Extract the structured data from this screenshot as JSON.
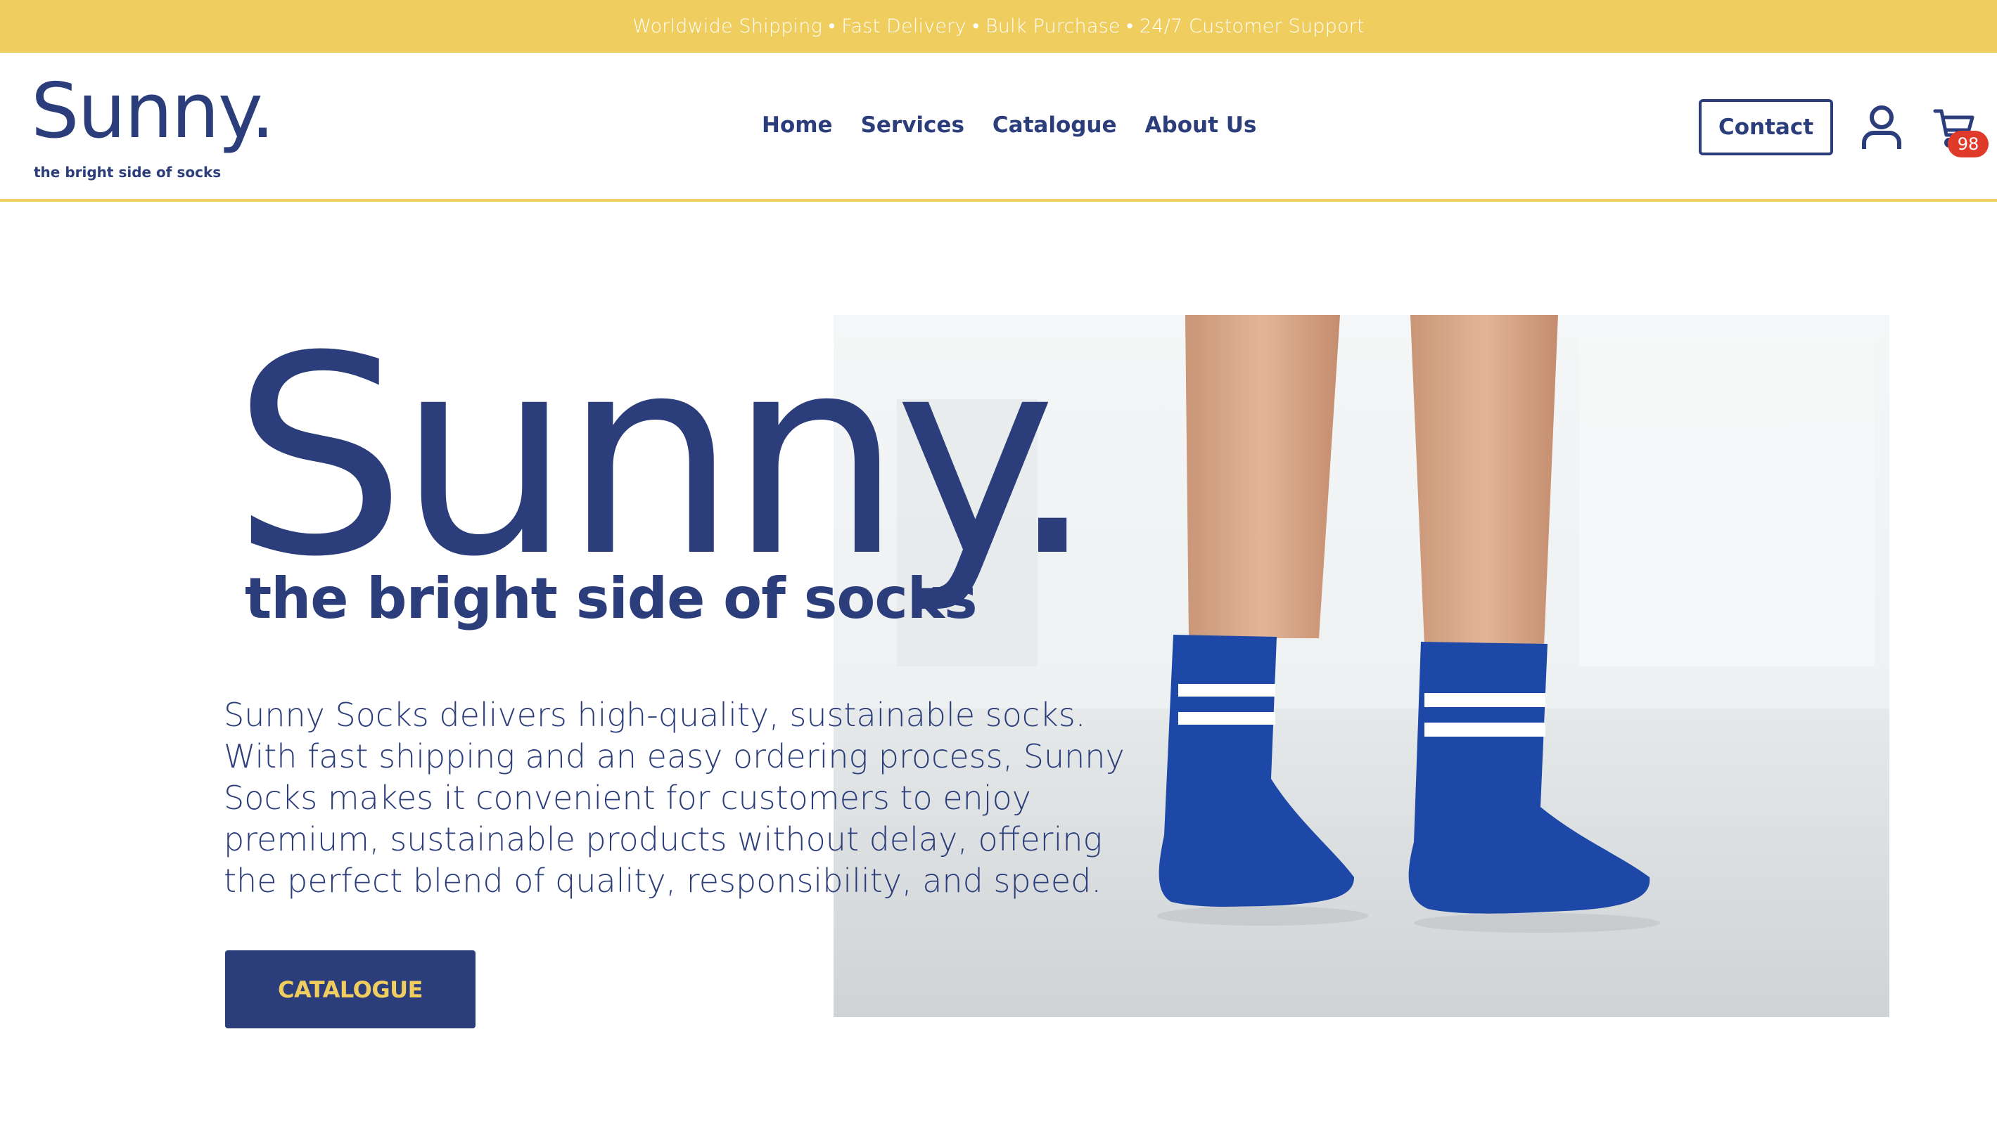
{
  "topbar": {
    "text": "Worldwide Shipping • Fast Delivery • Bulk Purchase • 24/7 Customer Support"
  },
  "brand": {
    "name": "Sunny.",
    "tagline": "the bright side of socks"
  },
  "nav": {
    "items": [
      "Home",
      "Services",
      "Catalogue",
      "About Us"
    ]
  },
  "header": {
    "contact_label": "Contact",
    "cart_count": "98"
  },
  "hero": {
    "title": "Sunny.",
    "tagline": "the bright side of socks",
    "description": "Sunny Socks delivers high-quality, sustainable socks. With fast shipping and an easy ordering process, Sunny Socks makes it convenient for customers to enjoy premium, sustainable products without delay, offering the perfect blend of quality, responsibility, and speed.",
    "cta_label": "CATALOGUE"
  },
  "icons": {
    "user": "user-icon",
    "cart": "cart-icon"
  },
  "colors": {
    "brand_navy": "#2b3d7a",
    "accent_yellow": "#efcd5e",
    "badge_red": "#e03a2b"
  }
}
